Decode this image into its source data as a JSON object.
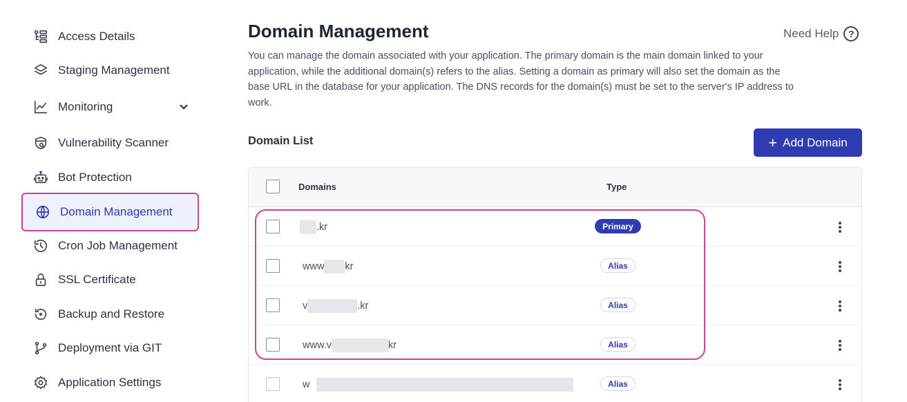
{
  "sidebar": {
    "items": [
      {
        "label": "Access Details"
      },
      {
        "label": "Staging Management"
      },
      {
        "label": "Monitoring"
      },
      {
        "label": "Vulnerability Scanner"
      },
      {
        "label": "Bot Protection"
      },
      {
        "label": "Domain Management"
      },
      {
        "label": "Cron Job Management"
      },
      {
        "label": "SSL Certificate"
      },
      {
        "label": "Backup and Restore"
      },
      {
        "label": "Deployment via GIT"
      },
      {
        "label": "Application Settings"
      }
    ],
    "active": "Domain Management"
  },
  "page": {
    "title": "Domain Management",
    "help_label": "Need Help",
    "description": "You can manage the domain associated with your application. The primary domain is the main domain linked to your application, while the additional domain(s) refers to the alias. Setting a domain as primary will also set the domain as the base URL in the database for your application. The DNS records for the domain(s) must be set to the server's IP address to work."
  },
  "domain_list": {
    "title": "Domain List",
    "add_button": "Add Domain",
    "columns": {
      "domains": "Domains",
      "type": "Type"
    },
    "rows": [
      {
        "prefix": "",
        "suffix": ".kr",
        "type": "Primary"
      },
      {
        "prefix": "www",
        "suffix": "kr",
        "type": "Alias"
      },
      {
        "prefix": "v",
        "suffix": ".kr",
        "type": "Alias"
      },
      {
        "prefix": "www.v",
        "suffix": "kr",
        "type": "Alias"
      },
      {
        "prefix": "w",
        "suffix": "",
        "type": "Alias"
      }
    ]
  },
  "colors": {
    "accent": "#2f3bb0",
    "highlight": "#c9468f"
  }
}
